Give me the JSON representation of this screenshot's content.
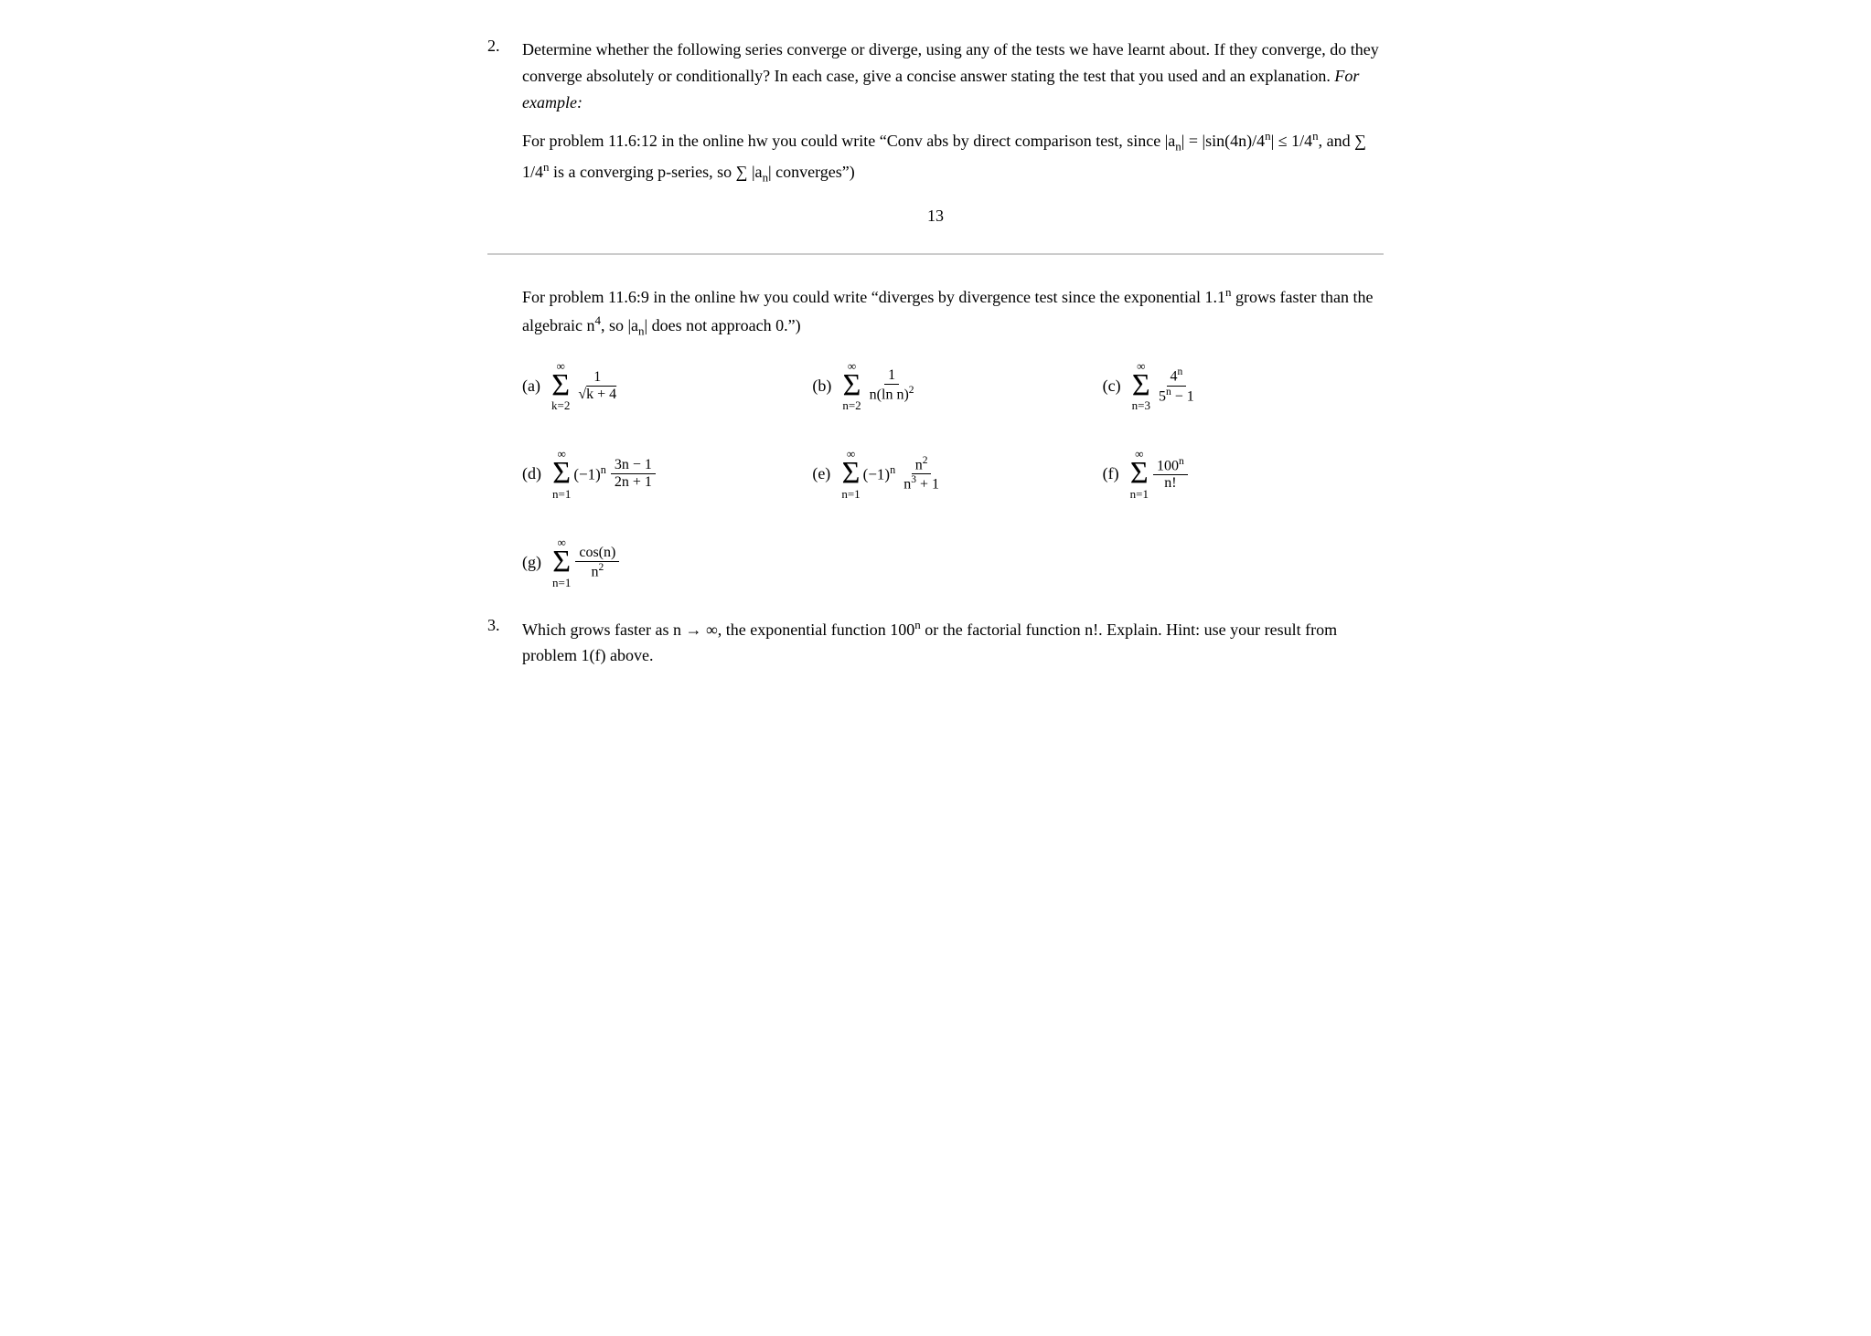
{
  "problem2": {
    "number": "2.",
    "intro": "Determine whether the following series converge or diverge, using any of the tests we have learnt about.  If they converge, do they converge absolutely or conditionally?  In each case, give a concise answer stating the test that you used and an explanation.",
    "italic_example": "For example:",
    "example_text": "For problem 11.6:12 in the online hw you could write “Conv abs by direct comparison test, since |a",
    "page_number": "13",
    "diverge_example": "For problem 11.6:9 in the online hw you could write “diverges by divergence test since the exponential 1.1",
    "diverge_example2": " grows faster than the algebraic n",
    "diverge_example3": ", so |a",
    "diverge_example4": "| does not approach 0.”",
    "series": {
      "a_label": "(a)",
      "b_label": "(b)",
      "c_label": "(c)",
      "d_label": "(d)",
      "e_label": "(e)",
      "f_label": "(f)",
      "g_label": "(g)"
    }
  },
  "problem3": {
    "number": "3.",
    "text": "Which grows faster as n → ∞, the exponential function 100",
    "text2": " or the factorial function n!. Explain. Hint: use your result from problem 1(f) above."
  }
}
